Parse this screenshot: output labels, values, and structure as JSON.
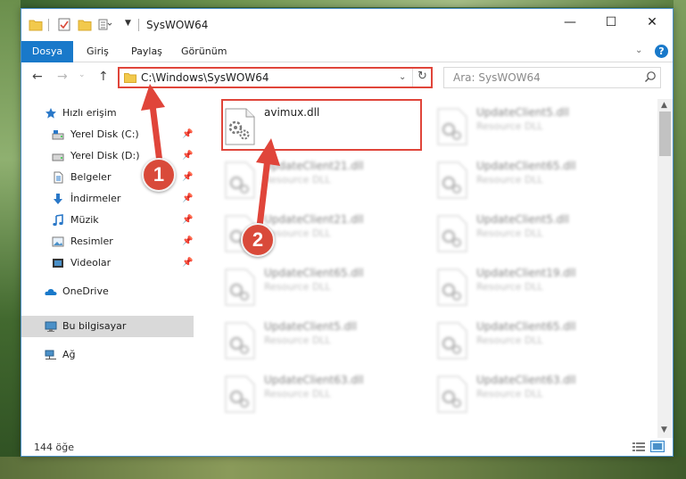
{
  "window": {
    "title": "SysWOW64",
    "minimize_glyph": "—",
    "maximize_glyph": "☐",
    "close_glyph": "✕"
  },
  "ribbon": {
    "tabs": [
      {
        "label": "Dosya",
        "active": true
      },
      {
        "label": "Giriş"
      },
      {
        "label": "Paylaş"
      },
      {
        "label": "Görünüm"
      }
    ],
    "help": "?",
    "accent_color": "#1979ca"
  },
  "nav": {
    "address": "C:\\Windows\\SysWOW64",
    "search_placeholder": "Ara: SysWOW64"
  },
  "sidebar": {
    "items": [
      {
        "label": "Hızlı erişim",
        "icon": "star-icon",
        "pinned": false
      },
      {
        "label": "Yerel Disk (C:)",
        "icon": "drive-c-icon",
        "pinned": true
      },
      {
        "label": "Yerel Disk (D:)",
        "icon": "drive-d-icon",
        "pinned": true
      },
      {
        "label": "Belgeler",
        "icon": "documents-icon",
        "pinned": true
      },
      {
        "label": "İndirmeler",
        "icon": "downloads-icon",
        "pinned": true
      },
      {
        "label": "Müzik",
        "icon": "music-icon",
        "pinned": true
      },
      {
        "label": "Resimler",
        "icon": "pictures-icon",
        "pinned": true
      },
      {
        "label": "Videolar",
        "icon": "videos-icon",
        "pinned": true
      },
      {
        "label": "OneDrive",
        "icon": "onedrive-icon",
        "pinned": false
      },
      {
        "label": "Bu bilgisayar",
        "icon": "this-pc-icon",
        "pinned": false,
        "selected": true
      },
      {
        "label": "Ağ",
        "icon": "network-icon",
        "pinned": false
      }
    ]
  },
  "files": {
    "focused": {
      "name": "avimux.dll",
      "type": ""
    },
    "left_column": [
      {
        "name": "UpdateClient21.dll",
        "type": "Resource DLL"
      },
      {
        "name": "UpdateClient21.dll",
        "type": "Resource DLL"
      },
      {
        "name": "UpdateClient65.dll",
        "type": "Resource DLL"
      },
      {
        "name": "UpdateClient5.dll",
        "type": "Resource DLL"
      },
      {
        "name": "UpdateClient63.dll",
        "type": "Resource DLL"
      }
    ],
    "right_column": [
      {
        "name": "UpdateClient5.dll",
        "type": "Resource DLL"
      },
      {
        "name": "UpdateClient65.dll",
        "type": "Resource DLL"
      },
      {
        "name": "UpdateClient5.dll",
        "type": "Resource DLL"
      },
      {
        "name": "UpdateClient19.dll",
        "type": "Resource DLL"
      },
      {
        "name": "UpdateClient65.dll",
        "type": "Resource DLL"
      },
      {
        "name": "UpdateClient63.dll",
        "type": "Resource DLL"
      }
    ]
  },
  "status": {
    "item_count": "144 öğe"
  },
  "annotations": {
    "badge_1": "1",
    "badge_2": "2",
    "highlight_color": "#e0453a"
  }
}
